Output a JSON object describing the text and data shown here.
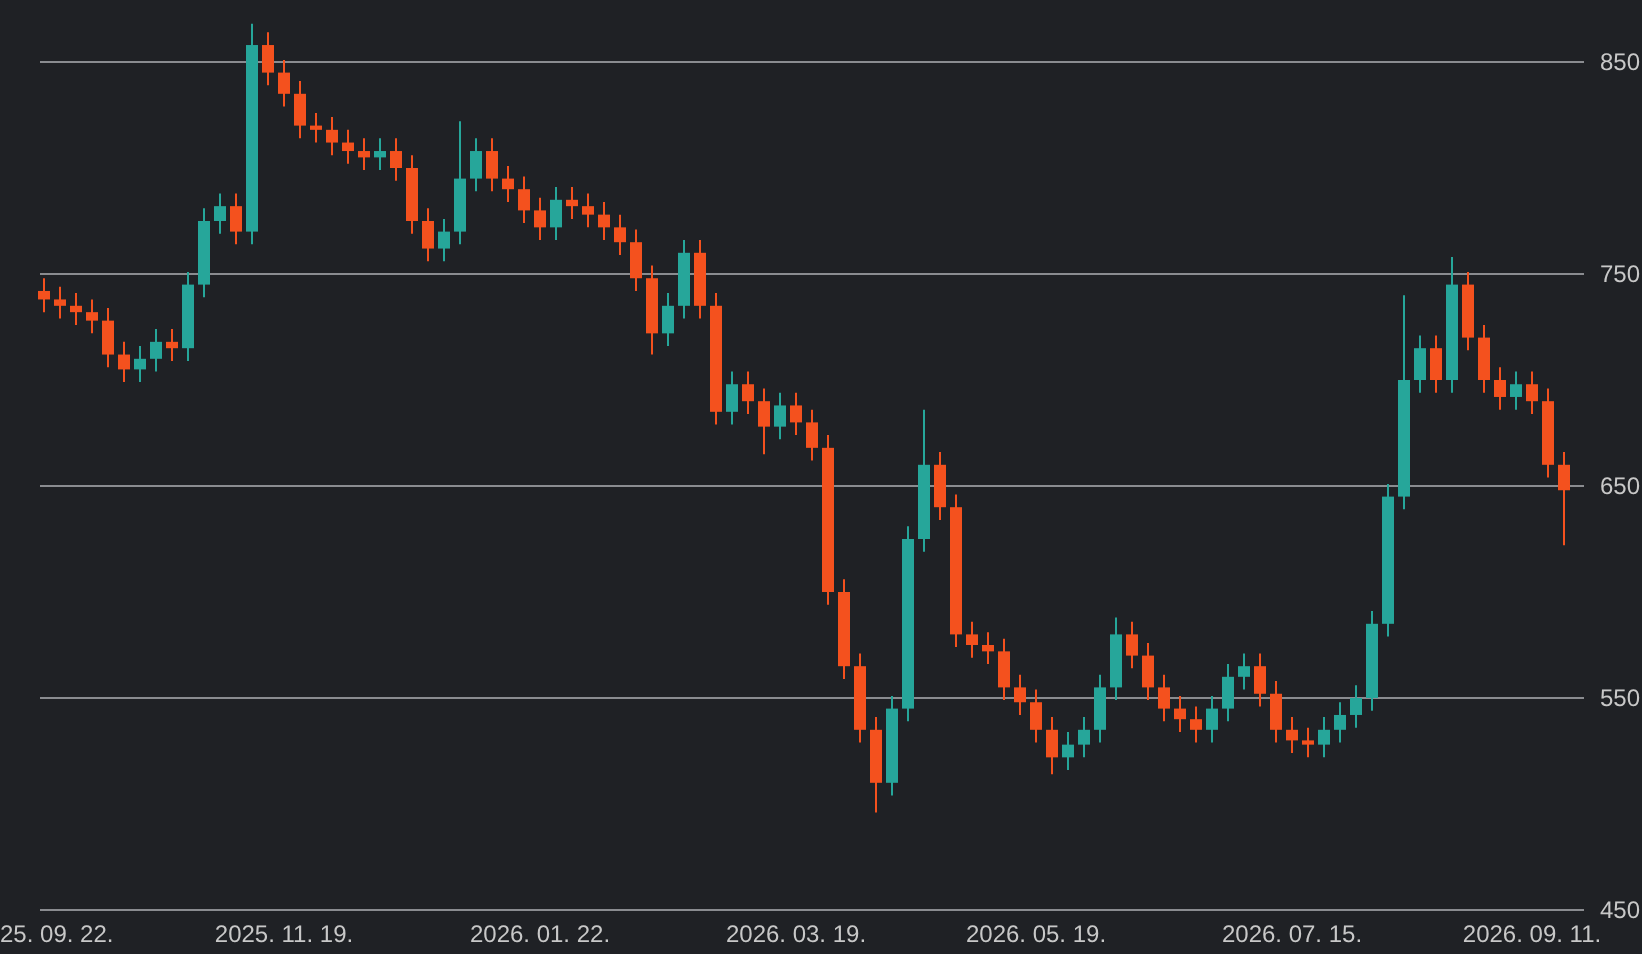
{
  "chart": {
    "chart_data": {
      "type": "candlestick",
      "grid": true,
      "ylim": [
        450,
        850
      ],
      "yticks": [
        450,
        550,
        650,
        750,
        850
      ],
      "categories": [
        "25. 09. 22.",
        null,
        null,
        null,
        null,
        null,
        null,
        null,
        null,
        null,
        null,
        null,
        null,
        null,
        null,
        "2025. 11. 19.",
        null,
        null,
        null,
        null,
        null,
        null,
        null,
        null,
        null,
        null,
        null,
        null,
        null,
        null,
        null,
        "2026. 01. 22.",
        null,
        null,
        null,
        null,
        null,
        null,
        null,
        null,
        null,
        null,
        null,
        null,
        null,
        null,
        null,
        "2026. 03. 19.",
        null,
        null,
        null,
        null,
        null,
        null,
        null,
        null,
        null,
        null,
        null,
        null,
        null,
        null,
        "2026. 05. 19.",
        null,
        null,
        null,
        null,
        null,
        null,
        null,
        null,
        null,
        null,
        null,
        null,
        null,
        null,
        null,
        "2026. 07. 15.",
        null,
        null,
        null,
        null,
        null,
        null,
        null,
        null,
        null,
        null,
        null,
        null,
        null,
        null,
        "2026. 09. 11.",
        null,
        null
      ],
      "ohlc": [
        [
          742,
          748,
          732,
          738
        ],
        [
          738,
          744,
          729,
          735
        ],
        [
          735,
          741,
          726,
          732
        ],
        [
          732,
          738,
          722,
          728
        ],
        [
          728,
          734,
          706,
          712
        ],
        [
          712,
          718,
          699,
          705
        ],
        [
          705,
          716,
          699,
          710
        ],
        [
          710,
          724,
          704,
          718
        ],
        [
          718,
          724,
          709,
          715
        ],
        [
          715,
          751,
          709,
          745
        ],
        [
          745,
          781,
          739,
          775
        ],
        [
          775,
          788,
          769,
          782
        ],
        [
          782,
          788,
          764,
          770
        ],
        [
          770,
          868,
          764,
          858
        ],
        [
          858,
          864,
          839,
          845
        ],
        [
          845,
          851,
          829,
          835
        ],
        [
          835,
          841,
          814,
          820
        ],
        [
          820,
          826,
          812,
          818
        ],
        [
          818,
          824,
          806,
          812
        ],
        [
          812,
          818,
          802,
          808
        ],
        [
          808,
          814,
          799,
          805
        ],
        [
          805,
          814,
          799,
          808
        ],
        [
          808,
          814,
          794,
          800
        ],
        [
          800,
          806,
          769,
          775
        ],
        [
          775,
          781,
          756,
          762
        ],
        [
          762,
          776,
          756,
          770
        ],
        [
          770,
          822,
          764,
          795
        ],
        [
          795,
          814,
          789,
          808
        ],
        [
          808,
          814,
          789,
          795
        ],
        [
          795,
          801,
          784,
          790
        ],
        [
          790,
          796,
          774,
          780
        ],
        [
          780,
          786,
          766,
          772
        ],
        [
          772,
          791,
          766,
          785
        ],
        [
          785,
          791,
          776,
          782
        ],
        [
          782,
          788,
          772,
          778
        ],
        [
          778,
          784,
          766,
          772
        ],
        [
          772,
          778,
          759,
          765
        ],
        [
          765,
          771,
          742,
          748
        ],
        [
          748,
          754,
          712,
          722
        ],
        [
          722,
          741,
          716,
          735
        ],
        [
          735,
          766,
          729,
          760
        ],
        [
          760,
          766,
          729,
          735
        ],
        [
          735,
          741,
          679,
          685
        ],
        [
          685,
          704,
          679,
          698
        ],
        [
          698,
          704,
          684,
          690
        ],
        [
          690,
          696,
          665,
          678
        ],
        [
          678,
          694,
          672,
          688
        ],
        [
          688,
          694,
          674,
          680
        ],
        [
          680,
          686,
          662,
          668
        ],
        [
          668,
          674,
          594,
          600
        ],
        [
          600,
          606,
          559,
          565
        ],
        [
          565,
          571,
          529,
          535
        ],
        [
          535,
          541,
          496,
          510
        ],
        [
          510,
          551,
          504,
          545
        ],
        [
          545,
          631,
          539,
          625
        ],
        [
          625,
          686,
          619,
          660
        ],
        [
          660,
          666,
          634,
          640
        ],
        [
          640,
          646,
          574,
          580
        ],
        [
          580,
          586,
          569,
          575
        ],
        [
          575,
          581,
          566,
          572
        ],
        [
          572,
          578,
          549,
          555
        ],
        [
          555,
          561,
          542,
          548
        ],
        [
          548,
          554,
          529,
          535
        ],
        [
          535,
          541,
          514,
          522
        ],
        [
          522,
          534,
          516,
          528
        ],
        [
          528,
          541,
          522,
          535
        ],
        [
          535,
          561,
          529,
          555
        ],
        [
          555,
          588,
          549,
          580
        ],
        [
          580,
          586,
          564,
          570
        ],
        [
          570,
          576,
          549,
          555
        ],
        [
          555,
          561,
          539,
          545
        ],
        [
          545,
          551,
          534,
          540
        ],
        [
          540,
          546,
          529,
          535
        ],
        [
          535,
          551,
          529,
          545
        ],
        [
          545,
          566,
          539,
          560
        ],
        [
          560,
          571,
          554,
          565
        ],
        [
          565,
          571,
          546,
          552
        ],
        [
          552,
          558,
          529,
          535
        ],
        [
          535,
          541,
          524,
          530
        ],
        [
          530,
          536,
          522,
          528
        ],
        [
          528,
          541,
          522,
          535
        ],
        [
          535,
          548,
          529,
          542
        ],
        [
          542,
          556,
          536,
          550
        ],
        [
          550,
          591,
          544,
          585
        ],
        [
          585,
          651,
          579,
          645
        ],
        [
          645,
          740,
          639,
          700
        ],
        [
          700,
          721,
          694,
          715
        ],
        [
          715,
          721,
          694,
          700
        ],
        [
          700,
          758,
          694,
          745
        ],
        [
          745,
          751,
          714,
          720
        ],
        [
          720,
          726,
          694,
          700
        ],
        [
          700,
          706,
          686,
          692
        ],
        [
          692,
          704,
          686,
          698
        ],
        [
          698,
          704,
          684,
          690
        ],
        [
          690,
          696,
          654,
          660
        ],
        [
          660,
          666,
          622,
          648
        ]
      ]
    }
  }
}
